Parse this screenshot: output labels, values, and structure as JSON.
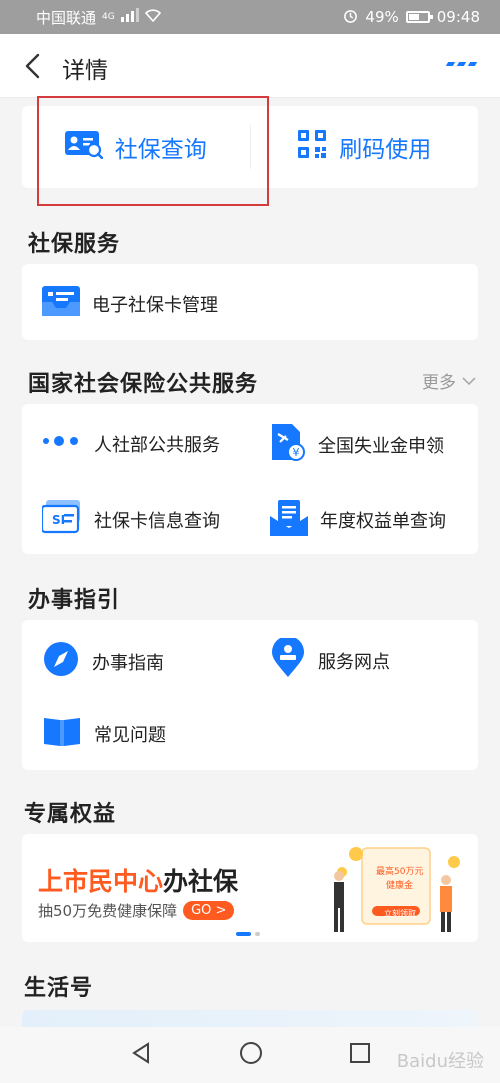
{
  "status_bar": {
    "carrier": "中国联通",
    "network": "4G",
    "battery": "49%",
    "time": "09:48"
  },
  "header": {
    "title": "详情"
  },
  "quick_actions": [
    {
      "label": "社保查询"
    },
    {
      "label": "刷码使用"
    }
  ],
  "sections": {
    "social_service": {
      "title": "社保服务",
      "items": [
        {
          "label": "电子社保卡管理"
        }
      ]
    },
    "national": {
      "title": "国家社会保险公共服务",
      "more_label": "更多",
      "items": [
        {
          "label": "人社部公共服务"
        },
        {
          "label": "全国失业金申领"
        },
        {
          "label": "社保卡信息查询"
        },
        {
          "label": "年度权益单查询"
        }
      ]
    },
    "guide": {
      "title": "办事指引",
      "items": [
        {
          "label": "办事指南"
        },
        {
          "label": "服务网点"
        },
        {
          "label": "常见问题"
        }
      ]
    },
    "benefits": {
      "title": "专属权益",
      "banner": {
        "headline_highlight": "上市民中心",
        "headline_rest": "办社保",
        "subtitle": "抽50万免费健康保障",
        "button": "GO >",
        "promo_badge": "最高50万元",
        "promo_text": "健康金",
        "promo_button": "立刻领取"
      }
    },
    "life": {
      "title": "生活号"
    }
  },
  "watermark": "Baidu经验",
  "colors": {
    "accent": "#1677ff",
    "orange": "#ff5a1f",
    "highlight_box": "#d63b3b"
  }
}
